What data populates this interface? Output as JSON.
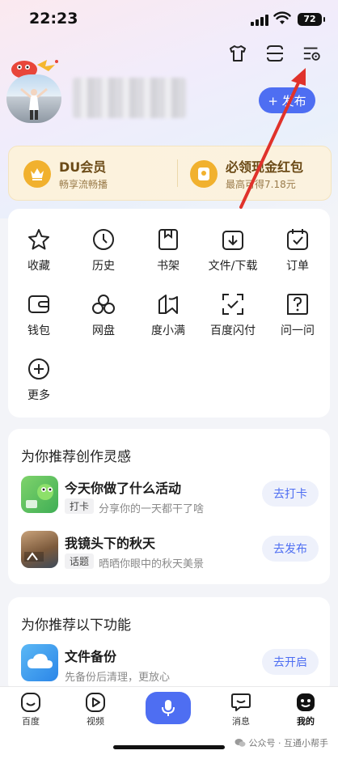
{
  "status_bar": {
    "time": "22:23",
    "battery": "72"
  },
  "profile": {
    "publish_label": "+ 发布"
  },
  "vip": {
    "left_title": "DU会员",
    "left_sub": "畅享流畅播",
    "right_title": "必领现金红包",
    "right_sub": "最高可得7.18元"
  },
  "services": [
    {
      "label": "收藏",
      "icon": "star-icon"
    },
    {
      "label": "历史",
      "icon": "clock-icon"
    },
    {
      "label": "书架",
      "icon": "bookshelf-icon"
    },
    {
      "label": "文件/下载",
      "icon": "download-icon"
    },
    {
      "label": "订单",
      "icon": "order-icon"
    },
    {
      "label": "钱包",
      "icon": "wallet-icon"
    },
    {
      "label": "网盘",
      "icon": "cloud-drive-icon"
    },
    {
      "label": "度小满",
      "icon": "duxiaoman-icon"
    },
    {
      "label": "百度闪付",
      "icon": "scan-pay-icon"
    },
    {
      "label": "问一问",
      "icon": "question-icon"
    },
    {
      "label": "更多",
      "icon": "plus-circle-icon"
    }
  ],
  "inspiration": {
    "title": "为你推荐创作灵感",
    "items": [
      {
        "title": "今天你做了什么活动",
        "tag": "打卡",
        "desc": "分享你的一天都干了啥",
        "button": "去打卡"
      },
      {
        "title": "我镜头下的秋天",
        "tag": "话题",
        "desc": "晒晒你眼中的秋天美景",
        "button": "去发布"
      }
    ]
  },
  "features": {
    "title": "为你推荐以下功能",
    "items": [
      {
        "title": "文件备份",
        "desc": "先备份后清理，更放心",
        "button": "去开启"
      }
    ]
  },
  "tabbar": [
    {
      "label": "百度",
      "icon": "baidu-icon"
    },
    {
      "label": "视频",
      "icon": "video-icon"
    },
    {
      "label": "消息",
      "icon": "message-icon"
    },
    {
      "label": "我的",
      "icon": "profile-icon"
    }
  ],
  "watermark": "公众号 · 互通小帮手",
  "colors": {
    "accent": "#4e6ef2",
    "annotation_arrow": "#e0322b"
  }
}
